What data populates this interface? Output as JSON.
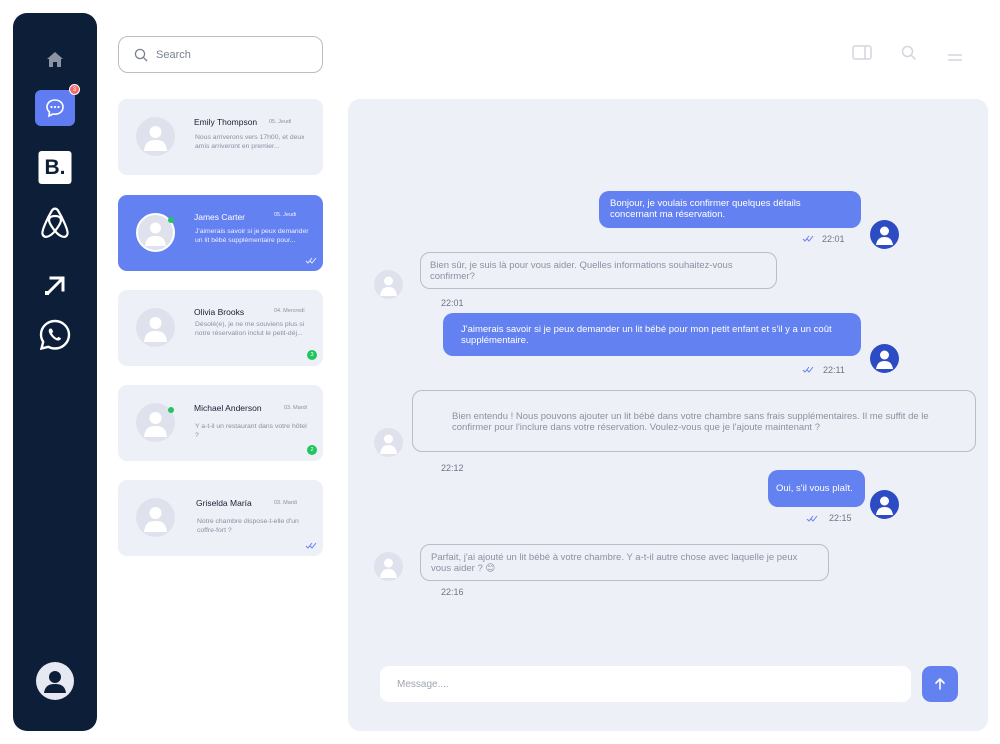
{
  "sidebar": {
    "chat_badge": "3",
    "booking_label": "B."
  },
  "search": {
    "placeholder": "Search"
  },
  "conversations": [
    {
      "name": "Emily Thompson",
      "day": "05. Jeudi",
      "preview": "Nous arriverons vers 17h00, et deux amis arriveront en premier..."
    },
    {
      "name": "James Carter",
      "day": "05. Jeudi",
      "preview": "J'aimerais savoir si je peux demander un lit bébé supplémentaire pour..."
    },
    {
      "name": "Olivia Brooks",
      "day": "04. Mercredi",
      "preview": "Désolé(e), je ne me souviens plus si notre réservation inclut le petit-déj...",
      "unread": "3"
    },
    {
      "name": "Michael Anderson",
      "day": "03. Mardi",
      "preview": "Y a-t-il un restaurant dans votre hôtel ?",
      "unread": "2"
    },
    {
      "name": "Griselda María",
      "day": "03. Mardi",
      "preview": "Notre chambre dispose-t-elle d'un coffre-fort ?"
    }
  ],
  "messages": [
    {
      "text": "Bonjour, je voulais confirmer quelques détails concernant ma réservation.",
      "time": "22:01"
    },
    {
      "text": "Bien sûr, je suis là pour vous aider. Quelles informations souhaitez-vous confirmer?",
      "time": "22:01"
    },
    {
      "text": "J'aimerais savoir si je peux demander un lit bébé pour mon petit enfant et s'il y a un coût supplémentaire.",
      "time": "22:11"
    },
    {
      "text": "Bien entendu ! Nous pouvons ajouter un lit bébé dans votre chambre sans frais supplémentaires. Il me suffit de le confirmer pour l'inclure dans votre réservation. Voulez-vous que je l'ajoute maintenant ?",
      "time": "22:12"
    },
    {
      "text": "Oui, s'il vous plaît.",
      "time": "22:15"
    },
    {
      "text": "Parfait, j'ai ajouté un lit bébé à votre chambre. Y a-t-il autre chose avec laquelle je peux vous aider ? 😊",
      "time": "22:16"
    }
  ],
  "composer": {
    "placeholder": "Message...."
  },
  "colors": {
    "sidebar": "#0c1e38",
    "accent": "#6481f1",
    "panel": "#eef0f8",
    "online": "#22c55e",
    "badge": "#f46a6a"
  }
}
